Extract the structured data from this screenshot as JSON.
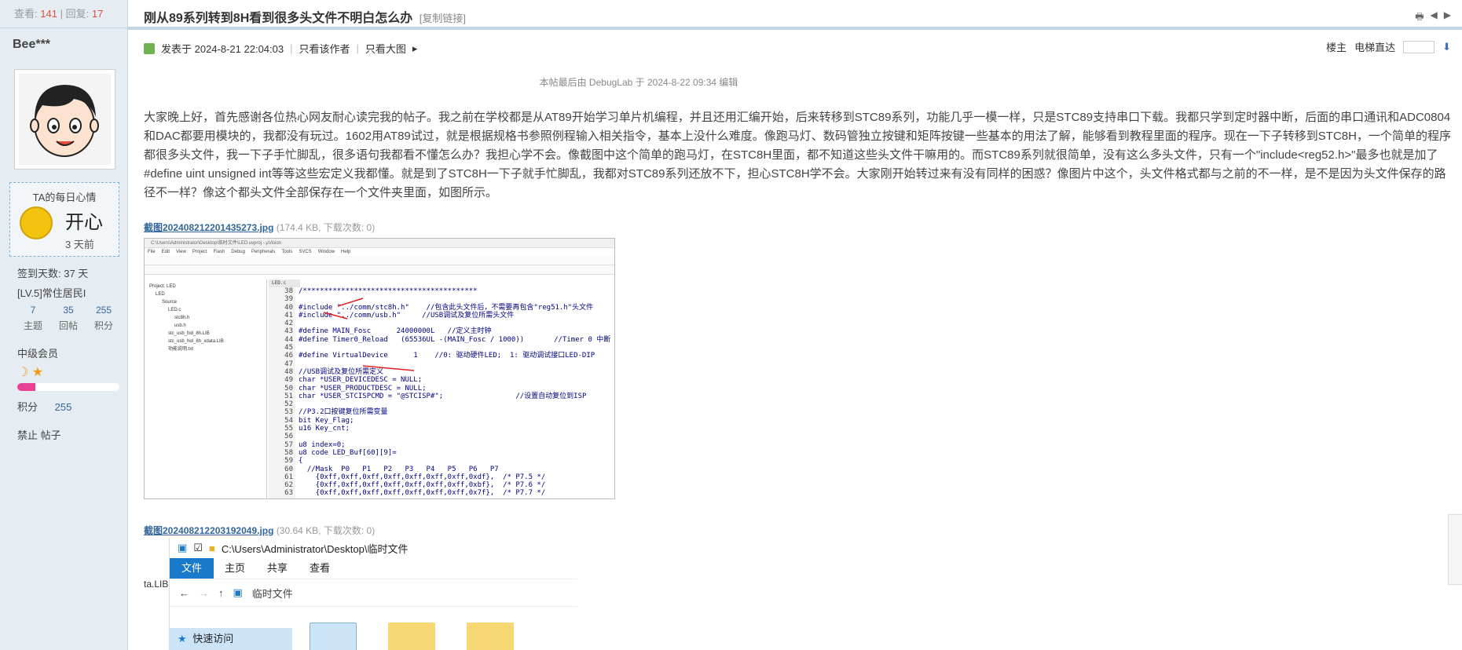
{
  "stats": {
    "views_label": "查看:",
    "views": "141",
    "sep": "|",
    "replies_label": "回复:",
    "replies": "17"
  },
  "thread": {
    "title": "刚从89系列转到8H看到很多头文件不明白怎么办",
    "copy_link": "[复制链接]"
  },
  "author": {
    "name": "Bee***"
  },
  "mood": {
    "title": "TA的每日心情",
    "text": "开心",
    "time": "3 天前"
  },
  "sidebar": {
    "checkin": "签到天数: 37 天",
    "level": "[LV.5]常住居民I",
    "trio": [
      {
        "value": "7",
        "label": "主题"
      },
      {
        "value": "35",
        "label": "回帖"
      },
      {
        "value": "255",
        "label": "积分"
      }
    ],
    "member": "中级会员",
    "points_label": "积分",
    "points_value": "255",
    "ban": "禁止 帖子"
  },
  "postinfo": {
    "posted": "发表于 2024-8-21 22:04:03",
    "only_author": "只看该作者",
    "only_images": "只看大图",
    "floor": "楼主",
    "elevator": "电梯直达"
  },
  "edited": "本帖最后由 DebugLab 于 2024-8-22 09:34 编辑",
  "body": "大家晚上好，首先感谢各位热心网友耐心读完我的帖子。我之前在学校都是从AT89开始学习单片机编程，并且还用汇编开始，后来转移到STC89系列，功能几乎一模一样，只是STC89支持串口下载。我都只学到定时器中断，后面的串口通讯和ADC0804和DAC都要用模块的，我都没有玩过。1602用AT89试过，就是根据规格书参照例程输入相关指令，基本上没什么难度。像跑马灯、数码管独立按键和矩阵按键一些基本的用法了解，能够看到教程里面的程序。现在一下子转移到STC8H，一个简单的程序都很多头文件，我一下子手忙脚乱，很多语句我都看不懂怎么办？我担心学不会。像截图中这个简单的跑马灯，在STC8H里面，都不知道这些头文件干嘛用的。而STC89系列就很简单，没有这么多头文件，只有一个\"include<reg52.h>\"最多也就是加了#define uint unsigned int等等这些宏定义我都懂。就是到了STC8H一下子就手忙脚乱，我都对STC89系列还放不下，担心STC8H学不会。大家刚开始转过来有没有同样的困惑？像图片中这个，头文件格式都与之前的不一样，是不是因为头文件保存的路径不一样？像这个都头文件全部保存在一个文件夹里面，如图所示。",
  "attachments": [
    {
      "name": "截图202408212201435273.jpg",
      "meta": "(174.4 KB, 下载次数: 0)"
    },
    {
      "name": "截图202408212203192049.jpg",
      "meta": "(30.64 KB, 下载次数: 0)"
    }
  ],
  "ide": {
    "title": "C:\\Users\\Administrator\\Desktop\\临时文件\\LED.uvproj - µVision",
    "menu": [
      "File",
      "Edit",
      "View",
      "Project",
      "Flash",
      "Debug",
      "Peripherals",
      "Tools",
      "SVCS",
      "Window",
      "Help"
    ],
    "tab": "LED.c",
    "tree": [
      "Project: LED",
      "LED",
      "Source",
      "LED.c",
      "stc8h.h",
      "usb.h",
      "stc_usb_hid_8h.LIB",
      "stc_usb_hid_8h_xdata.LIB",
      "功能说明.txt"
    ],
    "gutter": "38\n39\n40\n41\n42\n43\n44\n45\n46\n47\n48\n49\n50\n51\n52\n53\n54\n55\n56\n57\n58\n59\n60\n61\n62\n63",
    "code": "/*****************************************\n\n#include \"../comm/stc8h.h\"    //包含此头文件后，不需要再包含\"reg51.h\"头文件\n#include \"../comm/usb.h\"     //USB调试及复位所需头文件\n\n#define MAIN_Fosc      24000000L   //定义主时钟\n#define Timer0_Reload   (65536UL -(MAIN_Fosc / 1000))       //Timer 0 中断\n\n#define VirtualDevice      1    //0: 驱动硬件LED;  1: 驱动调试接口LED-DIP\n\n//USB调试及复位所需定义\nchar *USER_DEVICEDESC = NULL;\nchar *USER_PRODUCTDESC = NULL;\nchar *USER_STCISPCMD = \"@STCISP#\";                 //设置自动复位到ISP\n\n//P3.2口按键复位所需变量\nbit Key_Flag;\nu16 Key_cnt;\n\nu8 index=0;\nu8 code LED_Buf[60][9]=\n{\n  //Mask  P0   P1   P2   P3   P4   P5   P6   P7\n    {0xff,0xff,0xff,0xff,0xff,0xff,0xff,0xdf},  /* P7.5 */\n    {0xff,0xff,0xff,0xff,0xff,0xff,0xff,0xbf},  /* P7.6 */\n    {0xff,0xff,0xff,0xff,0xff,0xff,0xff,0x7f},  /* P7.7 */"
  },
  "explorer": {
    "path": "C:\\Users\\Administrator\\Desktop\\临时文件",
    "ribbon": [
      "文件",
      "主页",
      "共享",
      "查看"
    ],
    "crumb": "临时文件",
    "nav_item": "快速访问",
    "partial_label": "ta.LIB"
  }
}
